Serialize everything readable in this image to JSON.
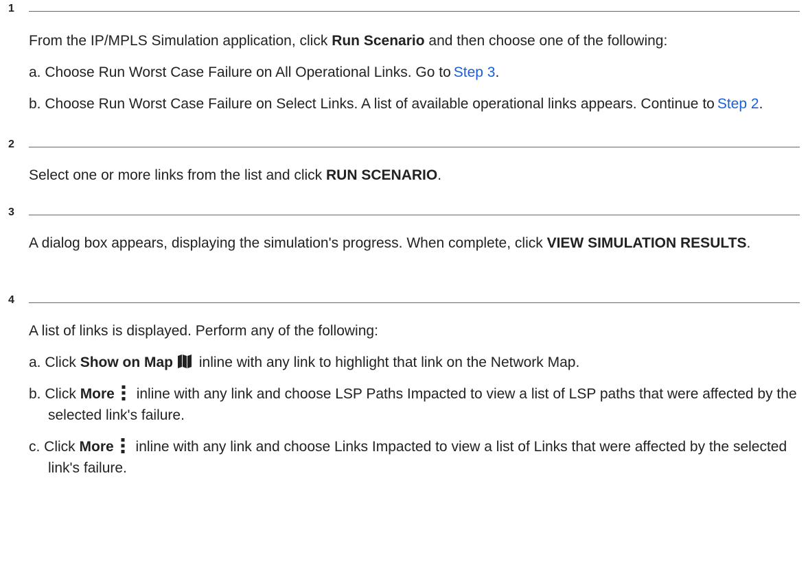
{
  "steps": [
    {
      "number": "1",
      "intro": {
        "pre": "From the IP/MPLS Simulation application, click ",
        "bold": "Run Scenario",
        "post": " and then choose one of the following:"
      },
      "items": [
        {
          "prefix": "a. Choose Run Worst Case Failure on All Operational Links. Go to",
          "link": "Step 3",
          "suffix": "."
        },
        {
          "prefix": "b. Choose Run Worst Case Failure on Select Links. A list of available operational links appears. Continue to",
          "link": "Step 2",
          "suffix": "."
        }
      ]
    },
    {
      "number": "2",
      "text": {
        "pre": "Select one or more links from the list and click ",
        "bold": "RUN SCENARIO",
        "post": "."
      }
    },
    {
      "number": "3",
      "text": {
        "pre": "A dialog box appears, displaying the simulation's progress. When complete, click ",
        "bold": "VIEW SIMULATION RESULTS",
        "post": "."
      }
    },
    {
      "number": "4",
      "intro": "A list of links is displayed. Perform any of the following:",
      "items": [
        {
          "pre": "a. Click ",
          "bold": "Show on Map",
          "icon": "map-icon",
          "post": " inline with any link to highlight that link on the Network Map."
        },
        {
          "pre": "b. Click ",
          "bold": "More",
          "icon": "more-vertical-icon",
          "post": " inline with any link and choose LSP Paths Impacted to view a list of LSP paths that were affected by the selected link's failure."
        },
        {
          "pre": "c. Click ",
          "bold": "More",
          "icon": "more-vertical-icon",
          "post": " inline with any link and choose Links Impacted to view a list of Links that were affected by the selected link's failure."
        }
      ]
    }
  ],
  "colors": {
    "link": "#1a5fd6",
    "text": "#222222",
    "rule": "#666666"
  }
}
